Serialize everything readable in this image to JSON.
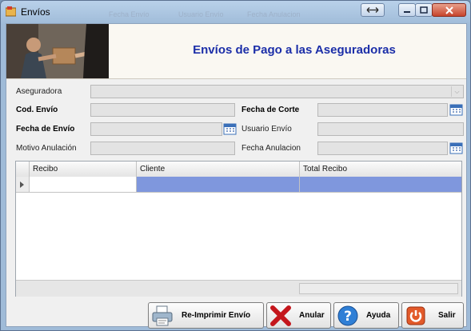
{
  "window": {
    "title": "Envíos",
    "background_tabs": [
      "Fecha Envío",
      "Usuario Envío",
      "Fecha Anulacion"
    ]
  },
  "header": {
    "title": "Envíos de Pago a las Aseguradoras"
  },
  "form": {
    "aseguradora_label": "Aseguradora",
    "cod_envio_label": "Cod. Envío",
    "fecha_corte_label": "Fecha de Corte",
    "fecha_envio_label": "Fecha de Envío",
    "usuario_envio_label": "Usuario Envío",
    "motivo_anulacion_label": "Motivo Anulación",
    "fecha_anulacion_label": "Fecha Anulacion"
  },
  "grid": {
    "columns": [
      "Recibo",
      "Cliente",
      "Total Recibo"
    ],
    "rows": [
      [
        "",
        "",
        ""
      ]
    ]
  },
  "buttons": {
    "reimprimir": "Re-Imprimir Envío",
    "anular": "Anular",
    "ayuda": "Ayuda",
    "salir": "Salir"
  },
  "icons": {
    "title": "app-form-icon",
    "calendar": "calendar-icon",
    "printer": "printer-icon",
    "cancel": "red-x-icon",
    "help": "question-icon",
    "exit": "power-icon"
  }
}
